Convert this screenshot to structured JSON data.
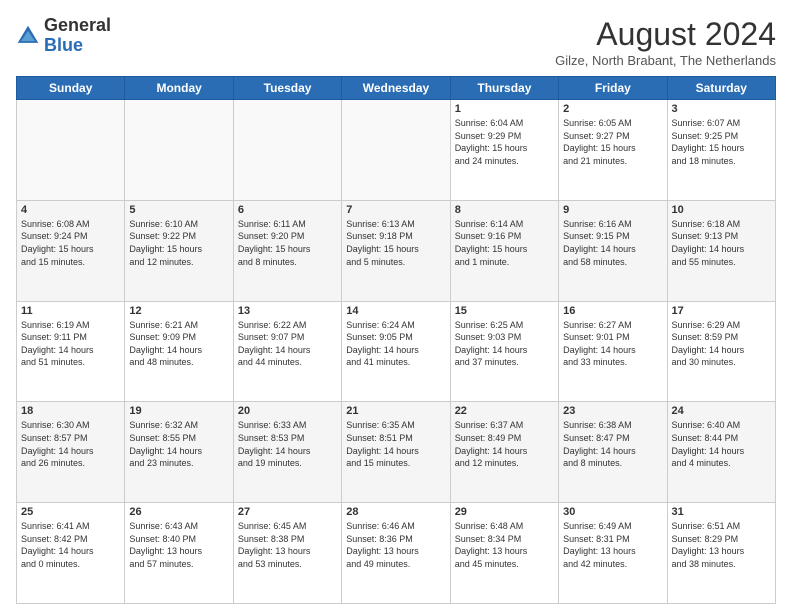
{
  "header": {
    "logo_general": "General",
    "logo_blue": "Blue",
    "month_year": "August 2024",
    "location": "Gilze, North Brabant, The Netherlands"
  },
  "days_of_week": [
    "Sunday",
    "Monday",
    "Tuesday",
    "Wednesday",
    "Thursday",
    "Friday",
    "Saturday"
  ],
  "weeks": [
    [
      {
        "day": "",
        "info": ""
      },
      {
        "day": "",
        "info": ""
      },
      {
        "day": "",
        "info": ""
      },
      {
        "day": "",
        "info": ""
      },
      {
        "day": "1",
        "info": "Sunrise: 6:04 AM\nSunset: 9:29 PM\nDaylight: 15 hours\nand 24 minutes."
      },
      {
        "day": "2",
        "info": "Sunrise: 6:05 AM\nSunset: 9:27 PM\nDaylight: 15 hours\nand 21 minutes."
      },
      {
        "day": "3",
        "info": "Sunrise: 6:07 AM\nSunset: 9:25 PM\nDaylight: 15 hours\nand 18 minutes."
      }
    ],
    [
      {
        "day": "4",
        "info": "Sunrise: 6:08 AM\nSunset: 9:24 PM\nDaylight: 15 hours\nand 15 minutes."
      },
      {
        "day": "5",
        "info": "Sunrise: 6:10 AM\nSunset: 9:22 PM\nDaylight: 15 hours\nand 12 minutes."
      },
      {
        "day": "6",
        "info": "Sunrise: 6:11 AM\nSunset: 9:20 PM\nDaylight: 15 hours\nand 8 minutes."
      },
      {
        "day": "7",
        "info": "Sunrise: 6:13 AM\nSunset: 9:18 PM\nDaylight: 15 hours\nand 5 minutes."
      },
      {
        "day": "8",
        "info": "Sunrise: 6:14 AM\nSunset: 9:16 PM\nDaylight: 15 hours\nand 1 minute."
      },
      {
        "day": "9",
        "info": "Sunrise: 6:16 AM\nSunset: 9:15 PM\nDaylight: 14 hours\nand 58 minutes."
      },
      {
        "day": "10",
        "info": "Sunrise: 6:18 AM\nSunset: 9:13 PM\nDaylight: 14 hours\nand 55 minutes."
      }
    ],
    [
      {
        "day": "11",
        "info": "Sunrise: 6:19 AM\nSunset: 9:11 PM\nDaylight: 14 hours\nand 51 minutes."
      },
      {
        "day": "12",
        "info": "Sunrise: 6:21 AM\nSunset: 9:09 PM\nDaylight: 14 hours\nand 48 minutes."
      },
      {
        "day": "13",
        "info": "Sunrise: 6:22 AM\nSunset: 9:07 PM\nDaylight: 14 hours\nand 44 minutes."
      },
      {
        "day": "14",
        "info": "Sunrise: 6:24 AM\nSunset: 9:05 PM\nDaylight: 14 hours\nand 41 minutes."
      },
      {
        "day": "15",
        "info": "Sunrise: 6:25 AM\nSunset: 9:03 PM\nDaylight: 14 hours\nand 37 minutes."
      },
      {
        "day": "16",
        "info": "Sunrise: 6:27 AM\nSunset: 9:01 PM\nDaylight: 14 hours\nand 33 minutes."
      },
      {
        "day": "17",
        "info": "Sunrise: 6:29 AM\nSunset: 8:59 PM\nDaylight: 14 hours\nand 30 minutes."
      }
    ],
    [
      {
        "day": "18",
        "info": "Sunrise: 6:30 AM\nSunset: 8:57 PM\nDaylight: 14 hours\nand 26 minutes."
      },
      {
        "day": "19",
        "info": "Sunrise: 6:32 AM\nSunset: 8:55 PM\nDaylight: 14 hours\nand 23 minutes."
      },
      {
        "day": "20",
        "info": "Sunrise: 6:33 AM\nSunset: 8:53 PM\nDaylight: 14 hours\nand 19 minutes."
      },
      {
        "day": "21",
        "info": "Sunrise: 6:35 AM\nSunset: 8:51 PM\nDaylight: 14 hours\nand 15 minutes."
      },
      {
        "day": "22",
        "info": "Sunrise: 6:37 AM\nSunset: 8:49 PM\nDaylight: 14 hours\nand 12 minutes."
      },
      {
        "day": "23",
        "info": "Sunrise: 6:38 AM\nSunset: 8:47 PM\nDaylight: 14 hours\nand 8 minutes."
      },
      {
        "day": "24",
        "info": "Sunrise: 6:40 AM\nSunset: 8:44 PM\nDaylight: 14 hours\nand 4 minutes."
      }
    ],
    [
      {
        "day": "25",
        "info": "Sunrise: 6:41 AM\nSunset: 8:42 PM\nDaylight: 14 hours\nand 0 minutes."
      },
      {
        "day": "26",
        "info": "Sunrise: 6:43 AM\nSunset: 8:40 PM\nDaylight: 13 hours\nand 57 minutes."
      },
      {
        "day": "27",
        "info": "Sunrise: 6:45 AM\nSunset: 8:38 PM\nDaylight: 13 hours\nand 53 minutes."
      },
      {
        "day": "28",
        "info": "Sunrise: 6:46 AM\nSunset: 8:36 PM\nDaylight: 13 hours\nand 49 minutes."
      },
      {
        "day": "29",
        "info": "Sunrise: 6:48 AM\nSunset: 8:34 PM\nDaylight: 13 hours\nand 45 minutes."
      },
      {
        "day": "30",
        "info": "Sunrise: 6:49 AM\nSunset: 8:31 PM\nDaylight: 13 hours\nand 42 minutes."
      },
      {
        "day": "31",
        "info": "Sunrise: 6:51 AM\nSunset: 8:29 PM\nDaylight: 13 hours\nand 38 minutes."
      }
    ]
  ]
}
